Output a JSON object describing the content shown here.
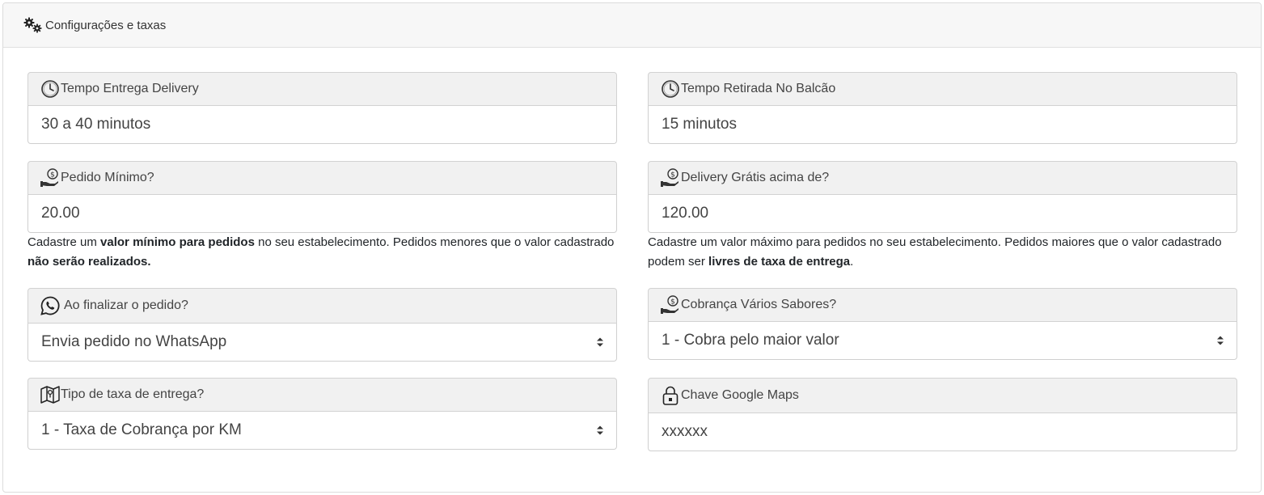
{
  "header": {
    "title": "Configurações e taxas",
    "icon": "gears-icon"
  },
  "fields": {
    "tempo_entrega": {
      "label": "Tempo Entrega Delivery",
      "value": "30 a 40 minutos",
      "icon": "clock-icon"
    },
    "tempo_retirada": {
      "label": "Tempo Retirada No Balcão",
      "value": "15 minutos",
      "icon": "clock-icon"
    },
    "pedido_minimo": {
      "label": "Pedido Mínimo?",
      "value": "20.00",
      "icon": "money-hand-icon"
    },
    "delivery_gratis": {
      "label": "Delivery Grátis acima de?",
      "value": "120.00",
      "icon": "money-hand-icon"
    },
    "finalizar_pedido": {
      "label": "Ao finalizar o pedido?",
      "value": "Envia pedido no WhatsApp",
      "icon": "whatsapp-icon"
    },
    "cobranca_sabores": {
      "label": "Cobrança Vários Sabores?",
      "value": "1 - Cobra pelo maior valor",
      "icon": "money-hand-icon"
    },
    "tipo_taxa": {
      "label": "Tipo de taxa de entrega?",
      "value": "1 - Taxa de Cobrança por KM",
      "icon": "map-icon"
    },
    "chave_maps": {
      "label": "Chave Google Maps",
      "value": "xxxxxx",
      "icon": "lock-icon"
    }
  },
  "help": {
    "minimo": {
      "p1": "Cadastre um ",
      "b1": "valor mínimo para pedidos",
      "p2": " no seu estabelecimento. Pedidos menores que o valor cadastrado ",
      "b2": "não serão realizados."
    },
    "maximo": {
      "p1": "Cadastre um valor máximo para pedidos no seu estabelecimento. Pedidos maiores que o valor cadastrado podem ser ",
      "b1": "livres de taxa de entrega",
      "p2": "."
    }
  }
}
